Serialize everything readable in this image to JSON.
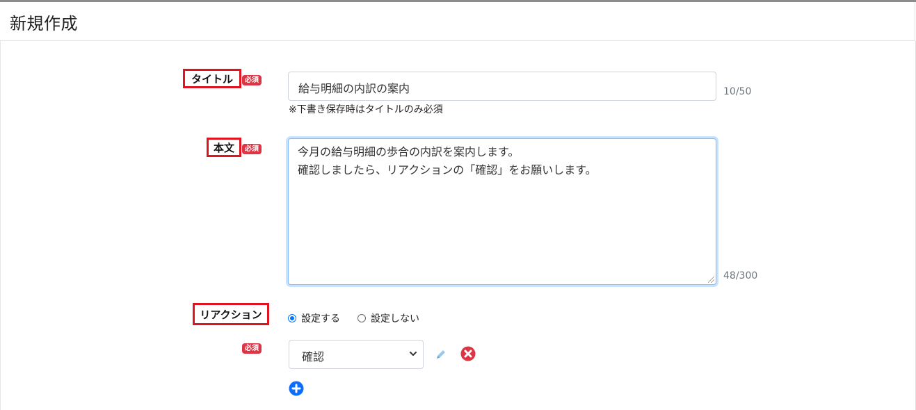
{
  "page": {
    "title": "新規作成"
  },
  "title_field": {
    "label": "タイトル",
    "required_badge": "必須",
    "value": "給与明細の内訳の案内",
    "counter": "10/50",
    "note": "※下書き保存時はタイトルのみ必須"
  },
  "body_field": {
    "label": "本文",
    "required_badge": "必須",
    "lines": [
      "今月の給与明細の歩合の内訳を案内します。",
      "確認しましたら、リアクションの「確認」をお願いします。"
    ],
    "counter": "48/300"
  },
  "reaction": {
    "label": "リアクション",
    "options": [
      {
        "label": "設定する",
        "selected": true
      },
      {
        "label": "設定しない",
        "selected": false
      }
    ],
    "item_required_badge": "必須",
    "select_value": "確認"
  },
  "colors": {
    "required": "#dc3545",
    "highlight_border": "#e0141e",
    "focus": "#80bdff",
    "delete": "#dc3545",
    "add": "#0d6efd",
    "edit": "#9cc8ea"
  },
  "icons": {
    "edit": "pencil-icon",
    "delete": "close-circle-icon",
    "add": "plus-circle-icon",
    "dropdown": "chevron-down-icon"
  }
}
